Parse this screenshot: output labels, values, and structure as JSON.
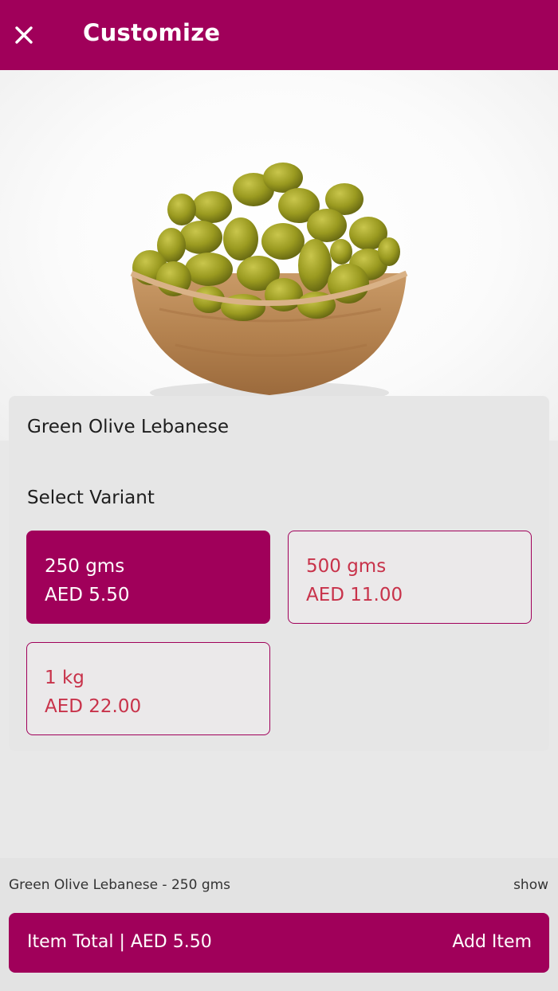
{
  "header": {
    "title": "Customize",
    "close_icon": "close-icon"
  },
  "colors": {
    "brand": "#a0005a",
    "variant_text": "#c8324a",
    "background": "#e8e8e8"
  },
  "product": {
    "name": "Green Olive Lebanese",
    "image": "green-olives-in-wooden-bowl"
  },
  "variants": {
    "label": "Select Variant",
    "selected_index": 0,
    "items": [
      {
        "size": "250 gms",
        "price": "AED 5.50"
      },
      {
        "size": "500 gms",
        "price": "AED 11.00"
      },
      {
        "size": "1 kg",
        "price": "AED 22.00"
      }
    ]
  },
  "summary": {
    "selection": "Green Olive Lebanese - 250 gms",
    "show_label": "show"
  },
  "footer": {
    "total_label": "Item Total | AED 5.50",
    "add_label": "Add Item"
  }
}
